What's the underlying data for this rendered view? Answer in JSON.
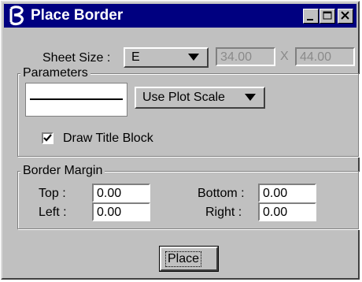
{
  "window": {
    "title": "Place Border"
  },
  "sheet": {
    "label": "Sheet Size :",
    "size_value": "E",
    "width": "34.00",
    "separator": "X",
    "height": "44.00"
  },
  "parameters": {
    "legend": "Parameters",
    "scale_option": "Use Plot Scale",
    "draw_title_block_label": "Draw Title Block",
    "draw_title_block_checked": true
  },
  "margin": {
    "legend": "Border Margin",
    "top_label": "Top :",
    "top_value": "0.00",
    "bottom_label": "Bottom :",
    "bottom_value": "0.00",
    "left_label": "Left :",
    "left_value": "0.00",
    "right_label": "Right :",
    "right_value": "0.00"
  },
  "actions": {
    "place_label": "Place"
  }
}
